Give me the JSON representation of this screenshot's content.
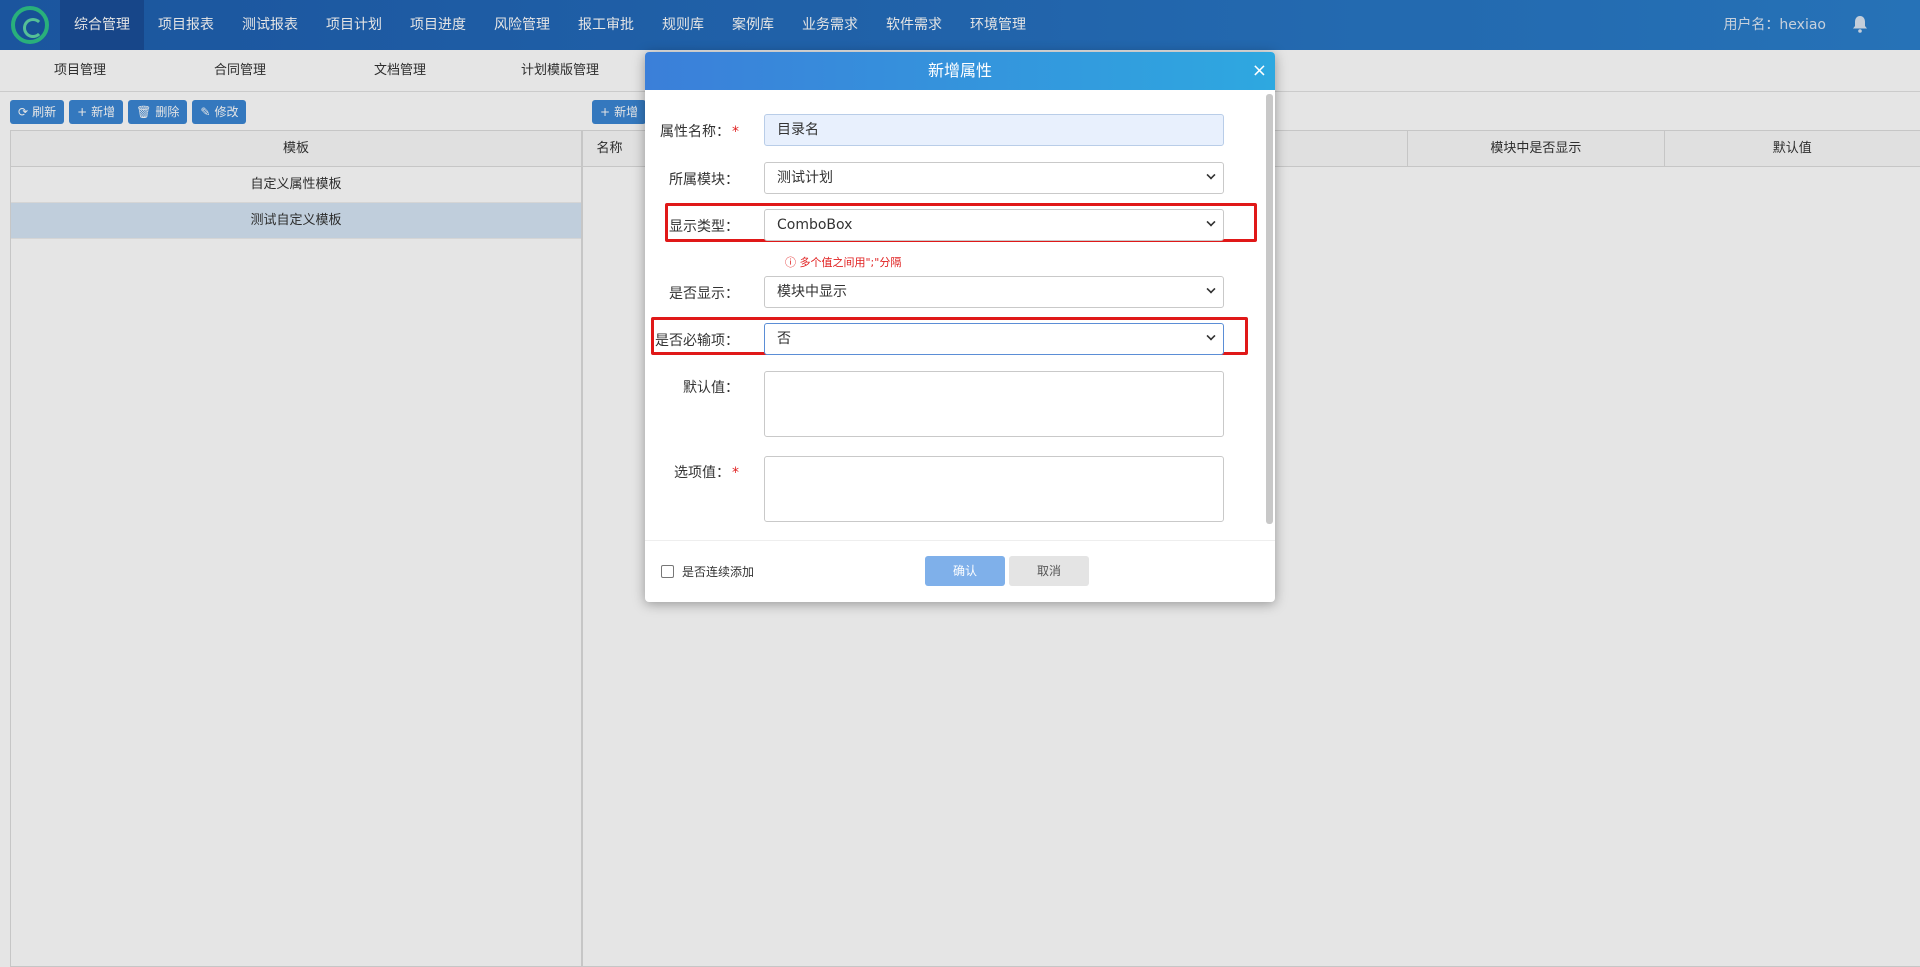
{
  "topnav": {
    "items": [
      "综合管理",
      "项目报表",
      "测试报表",
      "项目计划",
      "项目进度",
      "风险管理",
      "报工审批",
      "规则库",
      "案例库",
      "业务需求",
      "软件需求",
      "环境管理"
    ],
    "active_index": 0,
    "user_label": "用户名：hexiao"
  },
  "subnav": {
    "items": [
      "项目管理",
      "合同管理",
      "文档管理",
      "计划模版管理"
    ]
  },
  "left_toolbar": {
    "refresh": "刷新",
    "add": "新增",
    "delete": "删除",
    "edit": "修改"
  },
  "left_table": {
    "header": "模板",
    "rows": [
      "自定义属性模板",
      "测试自定义模板"
    ],
    "selected_index": 1
  },
  "right_toolbar": {
    "add": "新增"
  },
  "right_table": {
    "headers": [
      "名称",
      "模块中是否显示",
      "默认值"
    ]
  },
  "dialog": {
    "title": "新增属性",
    "close_glyph": "×",
    "fields": {
      "name_label": "属性名称：",
      "name_value": "目录名",
      "module_label": "所属模块：",
      "module_value": "测试计划",
      "display_type_label": "显示类型：",
      "display_type_value": "ComboBox",
      "hint": "多个值之间用\";\"分隔",
      "show_label": "是否显示：",
      "show_value": "模块中显示",
      "required_label": "是否必输项：",
      "required_value": "否",
      "default_label": "默认值：",
      "options_label": "选项值："
    },
    "required_marker": "*",
    "continue_label": "是否连续添加",
    "ok_label": "确认",
    "cancel_label": "取消"
  },
  "colors": {
    "nav_bg": "#2b7fcc",
    "dialog_header": "#3b7fd9",
    "highlight": "#e01818",
    "required": "#e02020"
  }
}
